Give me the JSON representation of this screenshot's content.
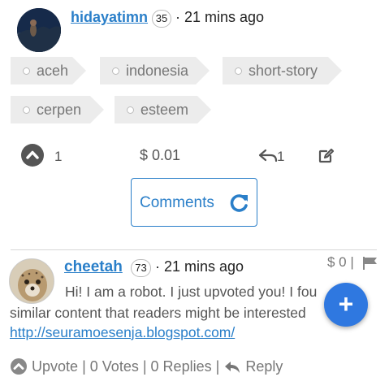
{
  "post": {
    "author": "hidayatimn",
    "reputation": "35",
    "time": "· 21 mins ago",
    "tags": [
      "aceh",
      "indonesia",
      "short-story",
      "cerpen",
      "esteem"
    ],
    "votes": "1",
    "payout": "$ 0.01",
    "reblogs": "1",
    "comments_button": "Comments"
  },
  "comment": {
    "author": "cheetah",
    "reputation": "73",
    "time": "· 21 mins ago",
    "payout": "$ 0 |",
    "body_line1": "Hi! I am a robot. I just upvoted you! I fou",
    "body_line2": "similar content that readers might be interested",
    "link": "http://seuramoesenja.blogspot.com/",
    "actions": {
      "upvote": "Upvote",
      "sep1": "|",
      "votes": "0 Votes",
      "sep2": "|",
      "replies": "0 Replies",
      "sep3": "|",
      "reply": "Reply"
    }
  },
  "fab_label": "+",
  "icons": {
    "upvote": "upvote-arrow-icon",
    "reply": "reply-arrow-icon",
    "edit": "edit-icon",
    "refresh": "refresh-icon",
    "flag": "flag-icon"
  },
  "colors": {
    "link": "#2a7fc9",
    "fab": "#2f78e0",
    "tag_bg": "#ececec"
  }
}
